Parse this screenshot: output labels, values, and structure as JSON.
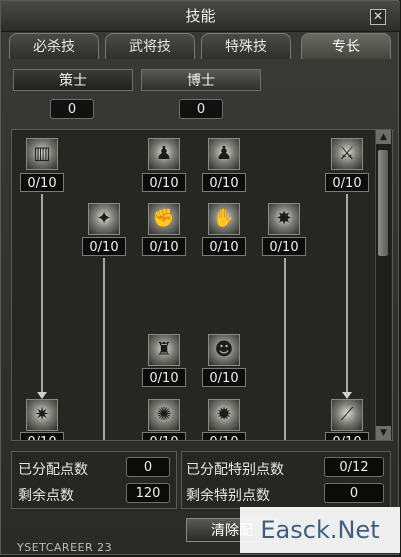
{
  "window": {
    "title": "技能",
    "close_glyph": "✕"
  },
  "tabs": [
    {
      "label": "必杀技",
      "active": false
    },
    {
      "label": "武将技",
      "active": false
    },
    {
      "label": "特殊技",
      "active": false
    },
    {
      "label": "专长",
      "active": true
    }
  ],
  "subtabs": [
    {
      "label": "策士",
      "points": "0",
      "active": false
    },
    {
      "label": "博士",
      "points": "0",
      "active": true
    }
  ],
  "skills": [
    {
      "icon": "barrel-icon",
      "level": "0/10"
    },
    {
      "icon": "warrior-icon",
      "level": "0/10"
    },
    {
      "icon": "warrior-dark-icon",
      "level": "0/10"
    },
    {
      "icon": "blade-slash-icon",
      "level": "0/10"
    },
    {
      "icon": "spark-icon",
      "level": "0/10"
    },
    {
      "icon": "fist-icon",
      "level": "0/10"
    },
    {
      "icon": "punch-icon",
      "level": "0/10"
    },
    {
      "icon": "claw-icon",
      "level": "0/10"
    },
    {
      "icon": "guardian-icon",
      "level": "0/10"
    },
    {
      "icon": "head-silhouette-icon",
      "level": "0/10"
    },
    {
      "icon": "burst-icon",
      "level": "0/10"
    },
    {
      "icon": "aura-icon",
      "level": "0/10"
    },
    {
      "icon": "orb-icon",
      "level": "0/10"
    },
    {
      "icon": "slash-icon",
      "level": "0/10"
    }
  ],
  "stats": {
    "allocated_label": "已分配点数",
    "allocated_value": "0",
    "remaining_label": "剩余点数",
    "remaining_value": "120",
    "special_allocated_label": "已分配特别点数",
    "special_allocated_value": "0/12",
    "special_remaining_label": "剩余特别点数",
    "special_remaining_value": "0"
  },
  "clear_button": "清除配",
  "footer_text": "YSETCAREER 23",
  "watermark": "Easck.Net",
  "scrollbar": {
    "up": "▲",
    "down": "▼"
  }
}
